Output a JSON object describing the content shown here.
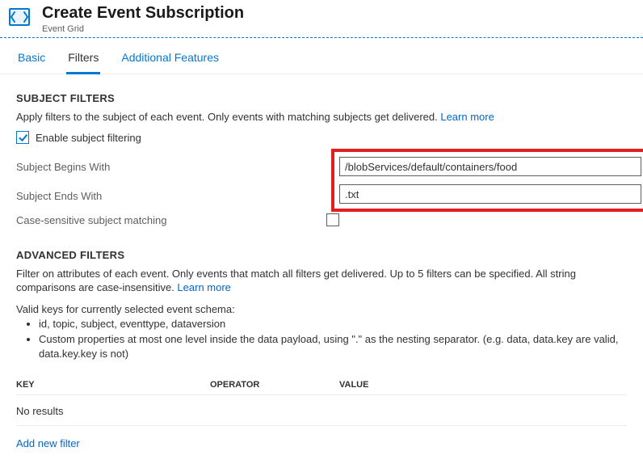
{
  "header": {
    "title": "Create Event Subscription",
    "subtitle": "Event Grid"
  },
  "tabs": {
    "basic": "Basic",
    "filters": "Filters",
    "additional": "Additional Features"
  },
  "subject": {
    "title": "SUBJECT FILTERS",
    "desc": "Apply filters to the subject of each event. Only events with matching subjects get delivered. ",
    "learn_more": "Learn more",
    "enable_label": "Enable subject filtering",
    "begins_label": "Subject Begins With",
    "begins_value": "/blobServices/default/containers/food",
    "ends_label": "Subject Ends With",
    "ends_value": ".txt",
    "case_label": "Case-sensitive subject matching"
  },
  "advanced": {
    "title": "ADVANCED FILTERS",
    "desc": "Filter on attributes of each event. Only events that match all filters get delivered. Up to 5 filters can be specified. All string comparisons are case-insensitive. ",
    "learn_more": "Learn more",
    "valid_intro": "Valid keys for currently selected event schema:",
    "bullet1": "id, topic, subject, eventtype, dataversion",
    "bullet2": "Custom properties at most one level inside the data payload, using \".\" as the nesting separator. (e.g. data, data.key are valid, data.key.key is not)",
    "th_key": "KEY",
    "th_op": "OPERATOR",
    "th_val": "VALUE",
    "no_results": "No results",
    "add_filter": "Add new filter"
  }
}
